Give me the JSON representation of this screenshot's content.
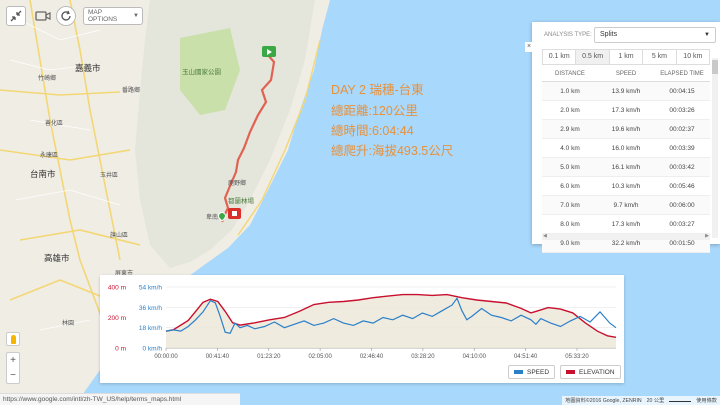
{
  "toolbar": {
    "map_options_label": "MAP OPTIONS"
  },
  "trip": {
    "title": "DAY 2 瑞穗-台東",
    "distance": "總距離:120公里",
    "time": "總時間:6:04:44",
    "climb": "總爬升:海拔493.5公尺"
  },
  "analysis": {
    "type_label": "ANALYSIS TYPE:",
    "type_value": "Splits",
    "tabs": [
      "0.1 km",
      "0.5 km",
      "1 km",
      "5 km",
      "10 km"
    ],
    "selected_tab": 1,
    "columns": [
      "DISTANCE",
      "SPEED",
      "ELAPSED TIME"
    ],
    "rows": [
      [
        "1.0 km",
        "13.9 km/h",
        "00:04:15"
      ],
      [
        "2.0 km",
        "17.3 km/h",
        "00:03:26"
      ],
      [
        "2.9 km",
        "19.6 km/h",
        "00:02:37"
      ],
      [
        "4.0 km",
        "16.0 km/h",
        "00:03:39"
      ],
      [
        "5.0 km",
        "16.1 km/h",
        "00:03:42"
      ],
      [
        "6.0 km",
        "10.3 km/h",
        "00:05:46"
      ],
      [
        "7.0 km",
        "9.7 km/h",
        "00:06:00"
      ],
      [
        "8.0 km",
        "17.3 km/h",
        "00:03:27"
      ],
      [
        "9.0 km",
        "32.2 km/h",
        "00:01:50"
      ]
    ]
  },
  "map_labels": {
    "cities": [
      "嘉義市",
      "台南市",
      "高雄市"
    ],
    "towns": [
      "番路鄉",
      "玉井區",
      "旗山區",
      "屏東市",
      "永康區",
      "善化區",
      "竹崎鄉",
      "鹿野鄉",
      "卑南鄉",
      "林園"
    ],
    "parks": [
      "玉山國家公園",
      "都蘭林場"
    ]
  },
  "chart_data": {
    "type": "line",
    "x_ticks": [
      "00:00:00",
      "00:41:40",
      "01:23:20",
      "02:05:00",
      "02:46:40",
      "03:28:20",
      "04:10:00",
      "04:51:40",
      "05:33:20"
    ],
    "y_left": {
      "unit": "m",
      "ticks": [
        "0 m",
        "200 m",
        "400 m"
      ],
      "range": [
        0,
        400
      ]
    },
    "y_right": {
      "unit": "km/h",
      "ticks": [
        "0 km/h",
        "18 km/h",
        "36 km/h",
        "54 km/h"
      ],
      "range": [
        0,
        54
      ]
    },
    "series": [
      {
        "name": "SPEED",
        "color": "#2a7fc9",
        "x_minutes": [
          0,
          6,
          12,
          18,
          24,
          30,
          36,
          40,
          44,
          48,
          52,
          56,
          60,
          66,
          72,
          80,
          88,
          96,
          104,
          112,
          120,
          128,
          136,
          144,
          152,
          160,
          168,
          176,
          184,
          192,
          200,
          208,
          216,
          224,
          232,
          236,
          240,
          244,
          248,
          256,
          264,
          272,
          280,
          288,
          296,
          300,
          304,
          312,
          320,
          328,
          336,
          344,
          352,
          360,
          365
        ],
        "values": [
          15,
          16,
          15,
          19,
          25,
          32,
          42,
          40,
          28,
          14,
          13,
          22,
          18,
          20,
          17,
          19,
          23,
          18,
          21,
          24,
          20,
          22,
          26,
          22,
          20,
          24,
          22,
          27,
          25,
          29,
          26,
          31,
          28,
          33,
          38,
          44,
          33,
          25,
          28,
          35,
          29,
          27,
          24,
          29,
          25,
          21,
          26,
          22,
          19,
          24,
          28,
          23,
          32,
          22,
          18
        ]
      },
      {
        "name": "ELEVATION",
        "color": "#c8102e",
        "x_minutes": [
          0,
          6,
          12,
          18,
          24,
          30,
          36,
          42,
          48,
          54,
          60,
          72,
          84,
          96,
          108,
          120,
          132,
          144,
          156,
          168,
          180,
          192,
          204,
          216,
          228,
          240,
          252,
          264,
          276,
          288,
          296,
          300,
          310,
          320,
          330,
          340,
          350,
          358,
          365
        ],
        "values": [
          110,
          120,
          150,
          180,
          240,
          300,
          320,
          305,
          240,
          165,
          150,
          165,
          185,
          200,
          240,
          285,
          300,
          305,
          315,
          330,
          340,
          350,
          350,
          345,
          350,
          330,
          315,
          305,
          295,
          260,
          230,
          240,
          265,
          255,
          230,
          165,
          110,
          80,
          70
        ]
      }
    ],
    "grid": true,
    "legend": "bottom-right"
  },
  "footer": {
    "url": "https://www.google.com/intl/zh-TW_US/help/terms_maps.html",
    "attribution": "地圖資料©2016 Google, ZENRIN",
    "scale": "20 公里",
    "terms": "使用條款"
  }
}
